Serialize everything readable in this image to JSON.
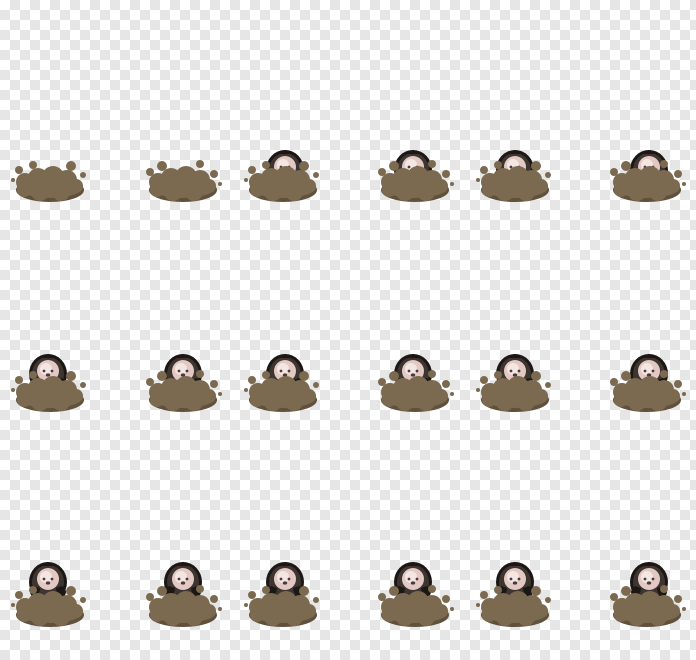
{
  "sprite_sheet": {
    "name": "mole-emerge",
    "colors": {
      "dirt": "#7b6a50",
      "dirt_shadow": "#5f513c",
      "mole_body": "#3d3530",
      "mole_outline": "#1c1714",
      "mole_face": "#e3c8c4",
      "mole_face_light": "#f3e6e3",
      "mole_eye": "#4a3a3a"
    },
    "frames": [
      {
        "row": 0,
        "col": 0,
        "mole_visible": false,
        "pose": "dirt-only"
      },
      {
        "row": 0,
        "col": 1,
        "mole_visible": false,
        "pose": "dirt-only"
      },
      {
        "row": 0,
        "col": 2,
        "mole_visible": true,
        "pose": "peek"
      },
      {
        "row": 0,
        "col": 3,
        "mole_visible": true,
        "pose": "peek"
      },
      {
        "row": 0,
        "col": 4,
        "mole_visible": true,
        "pose": "peek"
      },
      {
        "row": 0,
        "col": 5,
        "mole_visible": true,
        "pose": "peek"
      },
      {
        "row": 1,
        "col": 0,
        "mole_visible": true,
        "pose": "half"
      },
      {
        "row": 1,
        "col": 1,
        "mole_visible": true,
        "pose": "half"
      },
      {
        "row": 1,
        "col": 2,
        "mole_visible": true,
        "pose": "half"
      },
      {
        "row": 1,
        "col": 3,
        "mole_visible": true,
        "pose": "half"
      },
      {
        "row": 1,
        "col": 4,
        "mole_visible": true,
        "pose": "half"
      },
      {
        "row": 1,
        "col": 5,
        "mole_visible": true,
        "pose": "half"
      },
      {
        "row": 2,
        "col": 0,
        "mole_visible": true,
        "pose": "full"
      },
      {
        "row": 2,
        "col": 1,
        "mole_visible": true,
        "pose": "full"
      },
      {
        "row": 2,
        "col": 2,
        "mole_visible": true,
        "pose": "full"
      },
      {
        "row": 2,
        "col": 3,
        "mole_visible": true,
        "pose": "full"
      },
      {
        "row": 2,
        "col": 4,
        "mole_visible": true,
        "pose": "full"
      },
      {
        "row": 2,
        "col": 5,
        "mole_visible": true,
        "pose": "full"
      }
    ]
  }
}
